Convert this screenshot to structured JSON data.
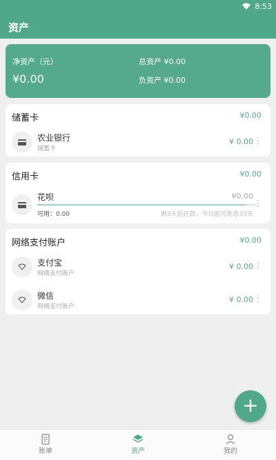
{
  "status": {
    "time": "8:53"
  },
  "header": {
    "title": "资产"
  },
  "summary": {
    "net_label": "净资产（元）",
    "net_value": "¥0.00",
    "total_label": "总资产 ¥0.00",
    "liability_label": "负资产 ¥0.00"
  },
  "sections": [
    {
      "title": "储蓄卡",
      "total": "¥0.00",
      "items": [
        {
          "name": "农业银行",
          "sub": "储蓄卡",
          "amount": "¥ 0.00",
          "icon": "card-icon"
        }
      ]
    },
    {
      "title": "信用卡",
      "total": "¥0.00",
      "items": [
        {
          "name": "花呗",
          "amount": "¥0.00",
          "available": "可用：0.00",
          "note": "剩3天后还款，今日起可免息33天",
          "progress": 0.95,
          "icon": "card-icon"
        }
      ]
    },
    {
      "title": "网络支付账户",
      "total": "¥0.00",
      "items": [
        {
          "name": "支付宝",
          "sub": "网络支付账户",
          "amount": "¥ 0.00",
          "icon": "wifi-icon"
        },
        {
          "name": "微信",
          "sub": "网络支付账户",
          "amount": "¥ 0.00",
          "icon": "wifi-icon"
        }
      ]
    }
  ],
  "fab": {
    "label": "+"
  },
  "nav": [
    {
      "label": "账单",
      "icon": "bill-icon"
    },
    {
      "label": "资产",
      "icon": "asset-icon",
      "active": true
    },
    {
      "label": "我的",
      "icon": "profile-icon"
    }
  ],
  "colors": {
    "primary": "#4fa88a",
    "accent_text": "#55a98c",
    "background": "#efefef"
  }
}
